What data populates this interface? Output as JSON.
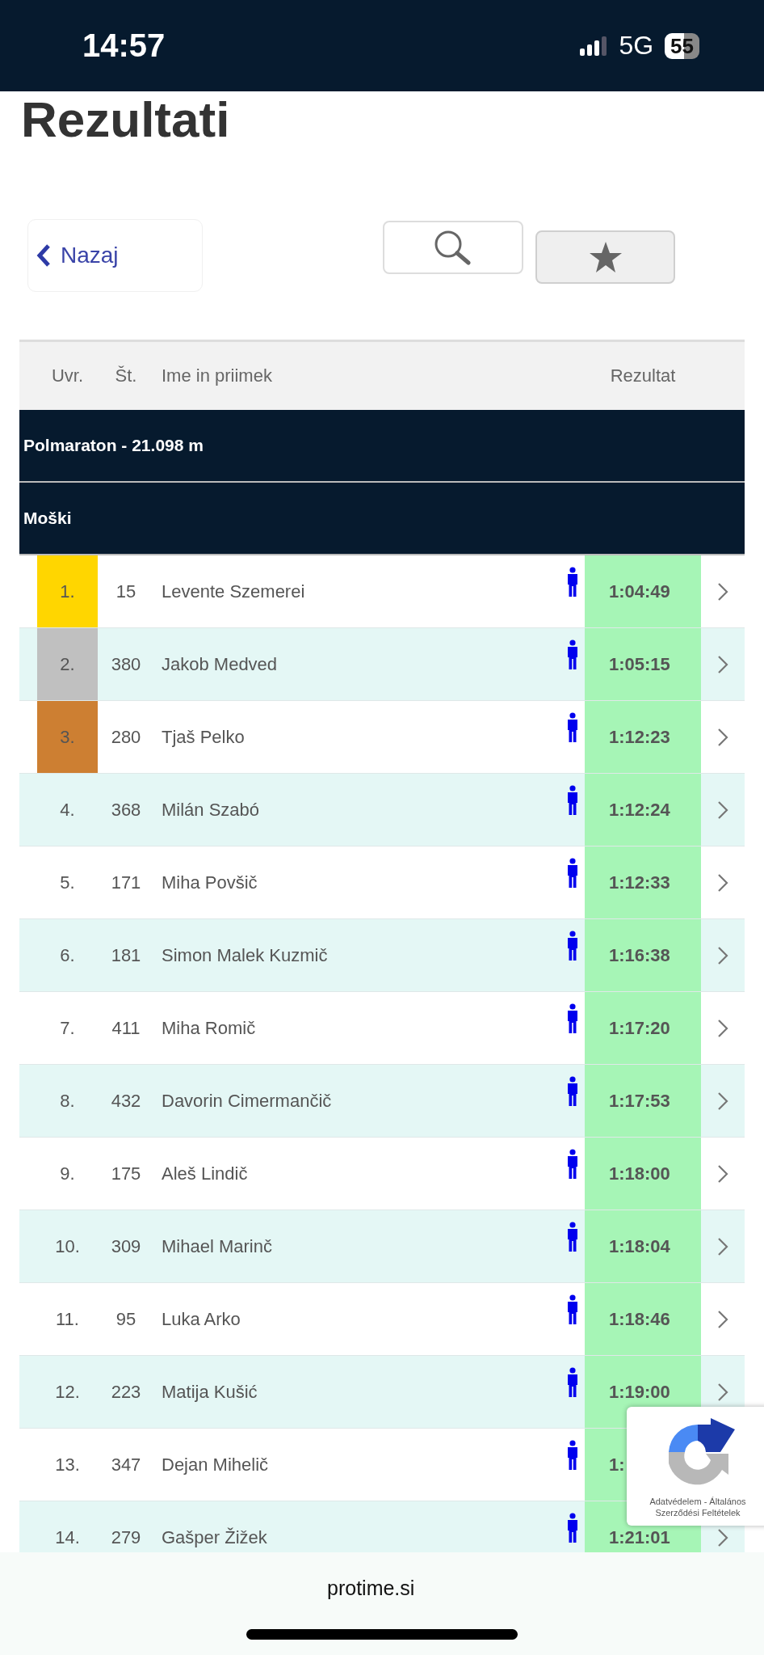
{
  "status_bar": {
    "time": "14:57",
    "network": "5G",
    "battery": "55"
  },
  "title": "Rezultati",
  "toolbar": {
    "back": "Nazaj"
  },
  "table": {
    "columns": [
      "Uvr.",
      "Št.",
      "Ime in priimek",
      "Rezultat"
    ],
    "sections": [
      "Polmaraton - 21.098 m",
      "Moški"
    ],
    "rows": [
      {
        "rank": "1.",
        "bib": "15",
        "name": "Levente Szemerei",
        "result": "1:04:49",
        "color": "#ffd600",
        "chevron": true
      },
      {
        "rank": "2.",
        "bib": "380",
        "name": "Jakob Medved",
        "result": "1:05:15",
        "color": "#c0c0c0",
        "chevron": true
      },
      {
        "rank": "3.",
        "bib": "280",
        "name": "Tjaš Pelko",
        "result": "1:12:23",
        "color": "#cd7f32",
        "chevron": true
      },
      {
        "rank": "4.",
        "bib": "368",
        "name": "Milán Szabó",
        "result": "1:12:24",
        "chevron": true
      },
      {
        "rank": "5.",
        "bib": "171",
        "name": "Miha Povšič",
        "result": "1:12:33",
        "chevron": true
      },
      {
        "rank": "6.",
        "bib": "181",
        "name": "Simon Malek Kuzmič",
        "result": "1:16:38",
        "chevron": true
      },
      {
        "rank": "7.",
        "bib": "411",
        "name": "Miha Romič",
        "result": "1:17:20",
        "chevron": true
      },
      {
        "rank": "8.",
        "bib": "432",
        "name": "Davorin Cimermančič",
        "result": "1:17:53",
        "chevron": true
      },
      {
        "rank": "9.",
        "bib": "175",
        "name": "Aleš Lindič",
        "result": "1:18:00",
        "chevron": true
      },
      {
        "rank": "10.",
        "bib": "309",
        "name": "Mihael Marinč",
        "result": "1:18:04",
        "chevron": true
      },
      {
        "rank": "11.",
        "bib": "95",
        "name": "Luka Arko",
        "result": "1:18:46",
        "chevron": true
      },
      {
        "rank": "12.",
        "bib": "223",
        "name": "Matija Kušić",
        "result": "1:19:00",
        "chevron": true
      },
      {
        "rank": "13.",
        "bib": "347",
        "name": "Dejan Mihelič",
        "result": "1:",
        "chevron": false
      },
      {
        "rank": "14.",
        "bib": "279",
        "name": "Gašper Žižek",
        "result": "1:21:01",
        "chevron": true
      }
    ]
  },
  "recaptcha": {
    "text": "Adatvédelem - Általános Szerződési Feltételek"
  },
  "browser_bar": {
    "url": "protime.si"
  }
}
